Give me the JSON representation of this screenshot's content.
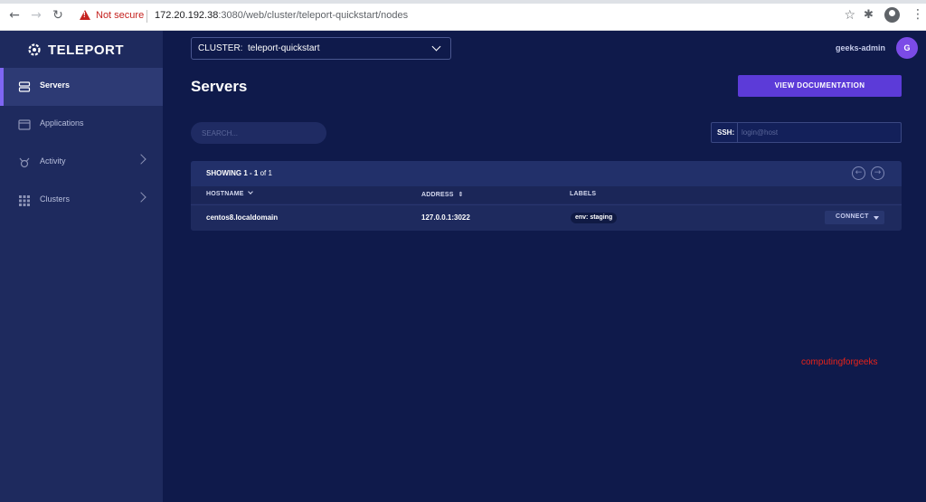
{
  "browser": {
    "security_label": "Not secure",
    "url_host": "172.20.192.38",
    "url_rest": ":3080/web/cluster/teleport-quickstart/nodes"
  },
  "sidebar": {
    "logo_text": "TELEPORT",
    "items": [
      {
        "label": "Servers",
        "icon": "server-icon",
        "active": true
      },
      {
        "label": "Applications",
        "icon": "application-icon"
      },
      {
        "label": "Activity",
        "icon": "activity-icon"
      },
      {
        "label": "Clusters",
        "icon": "clusters-icon"
      }
    ]
  },
  "topbar": {
    "cluster_prefix": "CLUSTER:",
    "cluster_name": "teleport-quickstart",
    "username": "geeks-admin",
    "avatar_initial": "G"
  },
  "main": {
    "title": "Servers",
    "doc_button": "VIEW DOCUMENTATION",
    "search_placeholder": "SEARCH...",
    "ssh_label": "SSH:",
    "ssh_placeholder": "login@host"
  },
  "table": {
    "showing_prefix": "SHOWING ",
    "showing_range": "1 - 1",
    "showing_suffix": " of 1",
    "columns": {
      "hostname": "HOSTNAME",
      "address": "ADDRESS",
      "labels": "LABELS"
    },
    "rows": [
      {
        "hostname": "centos8.localdomain",
        "address": "127.0.0.1:3022",
        "label": "env: staging",
        "action": "CONNECT"
      }
    ]
  },
  "watermark": "computingforgeeks",
  "colors": {
    "accent": "#5c3bd8",
    "background": "#0f1a4b",
    "sidebar": "#1e2a5e",
    "avatar": "#7b4be7"
  }
}
